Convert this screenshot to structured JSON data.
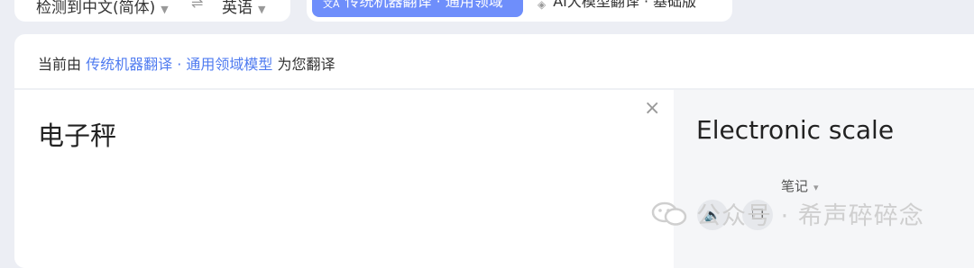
{
  "language_bar": {
    "source_language": "检测到中文(简体)",
    "swap_icon": "swap-arrows",
    "target_language": "英语"
  },
  "modes": {
    "active": {
      "label": "传统机器翻译 · 通用领域",
      "selected": true
    },
    "ai": {
      "label": "AI大模型翻译 · 基础版",
      "selected": false
    }
  },
  "notice": {
    "prefix": "当前由",
    "link": "传统机器翻译 · 通用领域模型",
    "suffix": "为您翻译"
  },
  "source": {
    "text": "电子秤"
  },
  "target": {
    "text": "Electronic scale"
  },
  "notes_label": "笔记",
  "watermark": {
    "text": "公众号 · 希声碎碎念"
  },
  "colors": {
    "accent": "#6e8efb",
    "link": "#4f7bf0",
    "page_bg": "#eceef4",
    "target_bg": "#f5f6f8"
  }
}
